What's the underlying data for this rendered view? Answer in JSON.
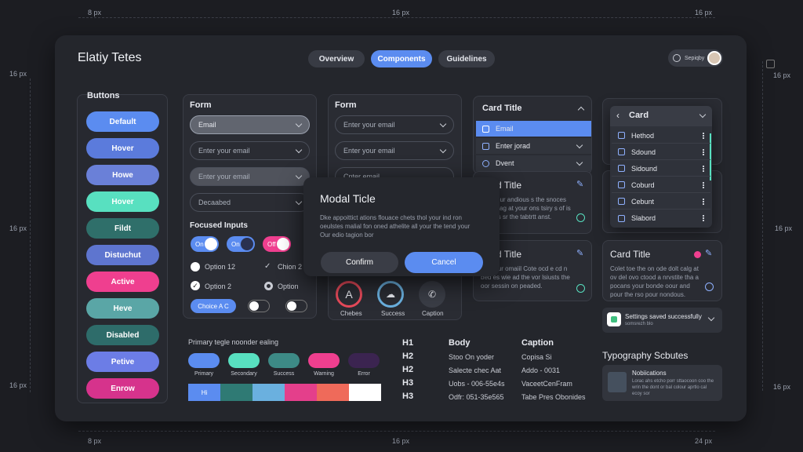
{
  "spacing": {
    "top_left": "8 px",
    "top_mid": "16 px",
    "top_right": "16 px",
    "left_1": "16 px",
    "left_2": "16 px",
    "left_3": "16 px",
    "right_1": "16 px",
    "right_2": "16 px",
    "right_3": "16 px",
    "bottom_left": "8 px",
    "bottom_mid": "16 px",
    "bottom_right": "24 px"
  },
  "header": {
    "title": "Elatiy Tetes",
    "tabs": [
      "Overview",
      "Components",
      "Guidelines"
    ],
    "user_label": "Sepiqby"
  },
  "buttons": {
    "title": "Buttons",
    "items": [
      {
        "label": "Default",
        "color": "#5b8cf0"
      },
      {
        "label": "Hover",
        "color": "#5b7bdc"
      },
      {
        "label": "Howe",
        "color": "#6a80d8"
      },
      {
        "label": "Hover",
        "color": "#58e0c0"
      },
      {
        "label": "Fildt",
        "color": "#2f6f6a"
      },
      {
        "label": "Distuchut",
        "color": "#5e75cf"
      },
      {
        "label": "Active",
        "color": "#ef3f8f"
      },
      {
        "label": "Heve",
        "color": "#5aa6a6"
      },
      {
        "label": "Disabled",
        "color": "#2e6c6a"
      },
      {
        "label": "Petive",
        "color": "#6c7de6"
      },
      {
        "label": "Enrow",
        "color": "#d6338c"
      }
    ]
  },
  "form1": {
    "title": "Form",
    "fields": [
      "Email",
      "Enter your email",
      "Enter your email",
      "Decaabed"
    ],
    "focused_title": "Focused Inputs",
    "toggles": [
      "On",
      "On",
      "Off"
    ],
    "option1": "Option 12",
    "option2": "Chion 2",
    "option3": "Option 2",
    "option4": "Option",
    "chip": "Choice A C"
  },
  "form2": {
    "title": "Form",
    "fields": [
      "Enter your email",
      "Enter your email",
      "Cnter email"
    ],
    "icons": [
      "Chebes",
      "Success",
      "Caption"
    ]
  },
  "modal": {
    "title": "Modal Ticle",
    "body": "Dke appoittict ations flouace chets thol your ind ron oeulstes malial fon oned athelite all your the tend your Our edio tagion bor",
    "confirm": "Confirm",
    "cancel": "Cancel"
  },
  "dropdown": {
    "title": "Card Title",
    "items": [
      "Email",
      "Enter jorad",
      "Dvent"
    ]
  },
  "card_mid1": {
    "title": "d Title",
    "body": "The your andious s the snoces ad ind ag at your ons tsiry s of is vesters sr the tabtrtt anst."
  },
  "card_mid2": {
    "title": "d Title",
    "body": "the your omaiil Cote ocd e cd n bed es wie ad the vor lsiusts the oor sessin on peaded."
  },
  "card_list": {
    "title": "Card",
    "items": [
      "Hethod",
      "Sdound",
      "Sidound",
      "Coburd",
      "Cebunt",
      "Slabord"
    ]
  },
  "card_right": {
    "title": "Card Title",
    "body": "Colet toe the on ode dolt calg at ov del ovo ctood a nrvstite tha a pocans your bonde oour and pour the rso pour nondous."
  },
  "toast": {
    "title": "Settings saved successfully",
    "subtitle": "somsrezh blo"
  },
  "palette": {
    "title": "Primary tegle noonder ealing",
    "chips": [
      {
        "label": "Primary",
        "color": "#5b8cf0"
      },
      {
        "label": "Secondary",
        "color": "#58e0c0"
      },
      {
        "label": "Success",
        "color": "#3d8a86"
      },
      {
        "label": "Warning",
        "color": "#ef3f8f"
      },
      {
        "label": "Error",
        "color": "#3b2450"
      }
    ],
    "swatch_label": "Hi",
    "swatches": [
      "#5b8cf0",
      "#2f7a74",
      "#6ab0df",
      "#e43f8b",
      "#ef6a5a",
      "#ffffff"
    ]
  },
  "typography": {
    "headings": [
      "H1",
      "H2",
      "H2",
      "H3",
      "H3"
    ],
    "body_title": "Body",
    "body_lines": [
      "Stoo On yoder",
      "Salecte chec Aat",
      "Uobs - 006-55e4s",
      "Odfr: 051-35e565"
    ],
    "caption_title": "Caption",
    "caption_lines": [
      "Copisa Si",
      "Addo - 0031",
      "VaceetCenFram",
      "Tabe Pres Obonides"
    ],
    "scales_title": "Typography Scbutes"
  },
  "notification": {
    "title": "Nobiications",
    "body": "Lorac ahs etcho porr sttaocoon coo the wrin the dont or bal colour aprtlo cal ecoy sor"
  }
}
